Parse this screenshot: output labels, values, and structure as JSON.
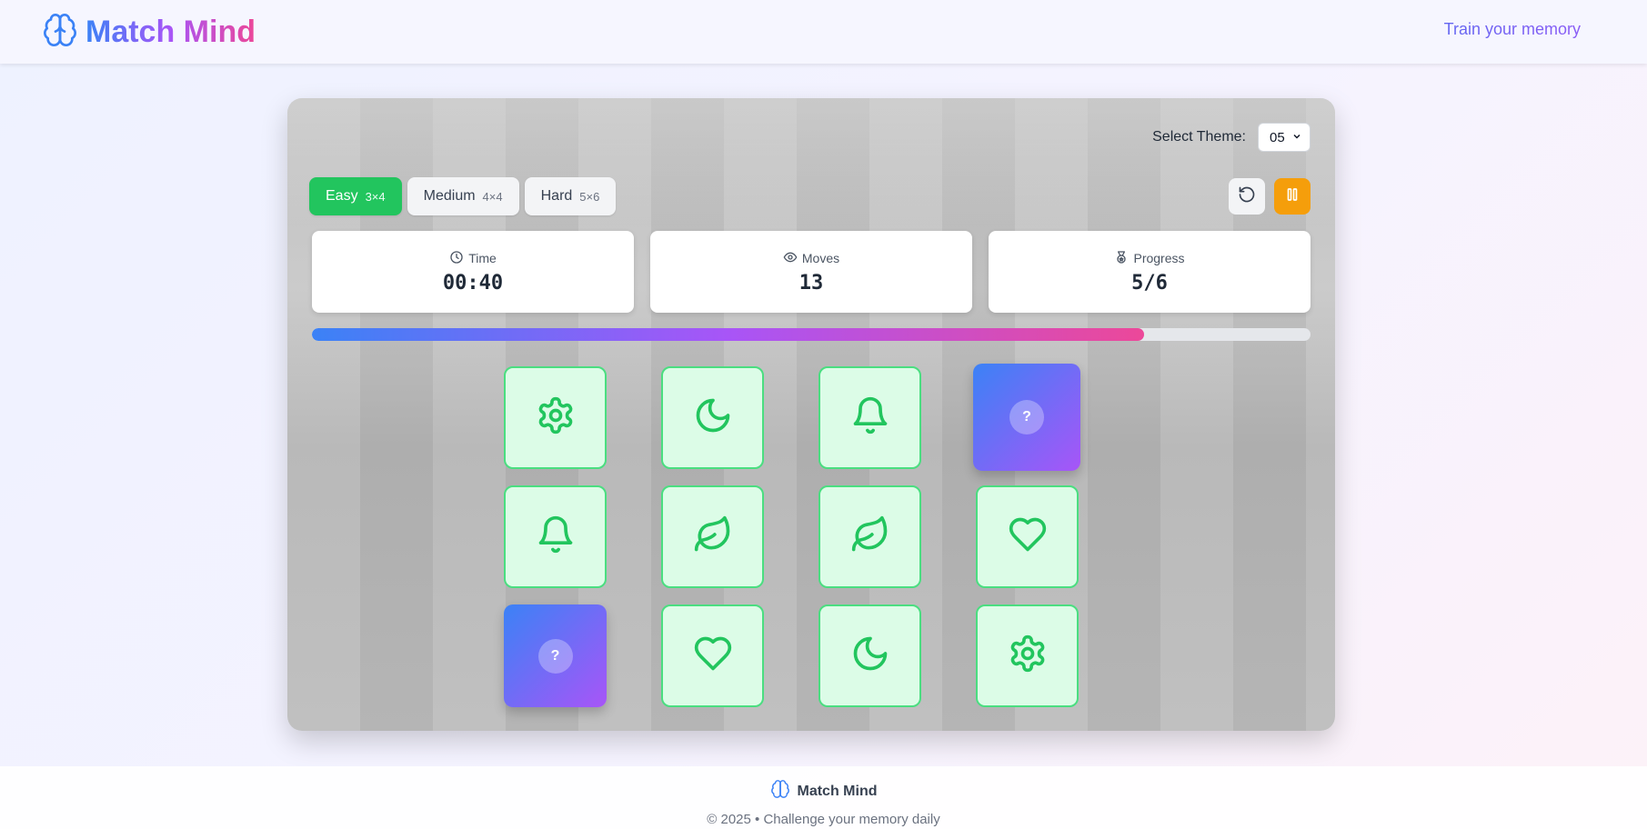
{
  "header": {
    "brand": "Match Mind",
    "tagline_link": "Train your memory"
  },
  "theme": {
    "label": "Select Theme:",
    "selected": "05"
  },
  "difficulty": [
    {
      "label": "Easy",
      "grid": "3×4",
      "active": true
    },
    {
      "label": "Medium",
      "grid": "4×4",
      "active": false
    },
    {
      "label": "Hard",
      "grid": "5×6",
      "active": false
    }
  ],
  "stats": {
    "time_label": "Time",
    "time_value": "00:40",
    "moves_label": "Moves",
    "moves_value": "13",
    "progress_label": "Progress",
    "progress_value": "5/6",
    "progress_fraction": 0.833
  },
  "cards": [
    {
      "state": "face",
      "icon": "gear-icon"
    },
    {
      "state": "face",
      "icon": "moon-icon"
    },
    {
      "state": "face",
      "icon": "bell-icon"
    },
    {
      "state": "back",
      "symbol": "?"
    },
    {
      "state": "face",
      "icon": "bell-icon"
    },
    {
      "state": "face",
      "icon": "leaf-icon"
    },
    {
      "state": "face",
      "icon": "leaf-icon"
    },
    {
      "state": "face",
      "icon": "heart-icon"
    },
    {
      "state": "back",
      "symbol": "?"
    },
    {
      "state": "face",
      "icon": "heart-icon"
    },
    {
      "state": "face",
      "icon": "moon-icon"
    },
    {
      "state": "face",
      "icon": "gear-icon"
    }
  ],
  "footer": {
    "brand": "Match Mind",
    "copyright": "© 2025 • Challenge your memory daily"
  },
  "colors": {
    "accent_green": "#22c55e",
    "pause_orange": "#f59e0b",
    "gradient_start": "#3b82f6",
    "gradient_mid": "#a855f7",
    "gradient_end": "#ec4899"
  }
}
